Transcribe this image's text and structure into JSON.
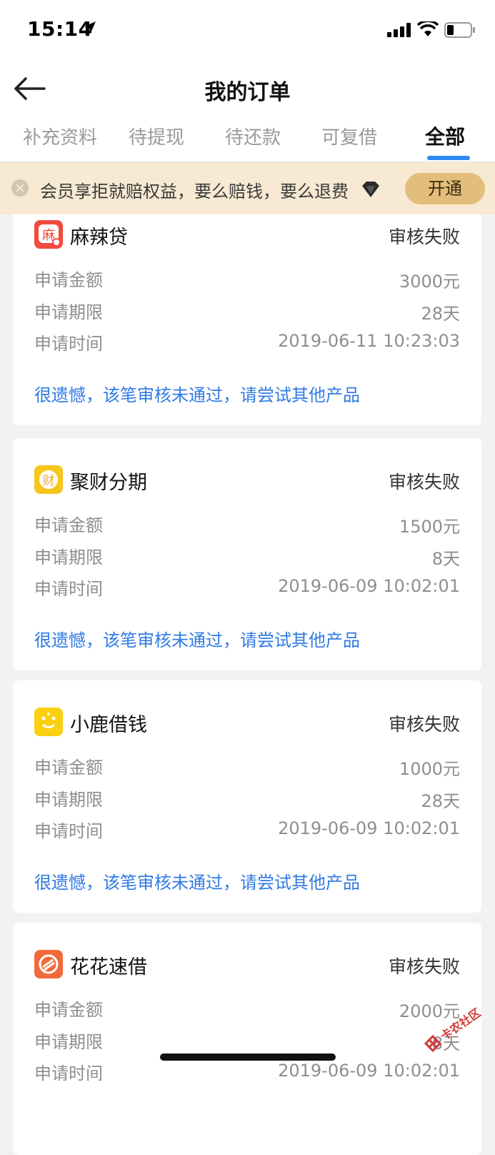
{
  "status_bar": {
    "time": "15:14"
  },
  "header": {
    "title": "我的订单"
  },
  "tabs": [
    {
      "label": "补充资料"
    },
    {
      "label": "待提现"
    },
    {
      "label": "待还款"
    },
    {
      "label": "可复借"
    },
    {
      "label": "全部",
      "active": true
    }
  ],
  "banner": {
    "text": "会员享拒就赔权益，要么赔钱，要么退费",
    "button": "开通"
  },
  "labels": {
    "amount": "申请金额",
    "term": "申请期限",
    "time": "申请时间"
  },
  "orders": [
    {
      "name": "麻辣贷",
      "logo_char": "麻",
      "logo_color": "#f24b3e",
      "status": "审核失败",
      "amount": "3000元",
      "term": "28天",
      "time": "2019-06-11 10:23:03",
      "message": "很遗憾，该笔审核未通过，请尝试其他产品"
    },
    {
      "name": "聚财分期",
      "logo_char": "财",
      "logo_color": "#f8c51c",
      "status": "审核失败",
      "amount": "1500元",
      "term": "8天",
      "time": "2019-06-09 10:02:01",
      "message": "很遗憾，该笔审核未通过，请尝试其他产品"
    },
    {
      "name": "小鹿借钱",
      "logo_char": "",
      "logo_color": "#fbd010",
      "status": "审核失败",
      "amount": "1000元",
      "term": "28天",
      "time": "2019-06-09 10:02:01",
      "message": "很遗憾，该笔审核未通过，请尝试其他产品"
    },
    {
      "name": "花花速借",
      "logo_char": "",
      "logo_color": "#f26a3a",
      "status": "审核失败",
      "amount": "2000元",
      "term": "8天",
      "time": "2019-06-09 10:02:01",
      "message": ""
    }
  ],
  "watermark": {
    "text": "卡农社区"
  },
  "colors": {
    "accent": "#2c8cf4",
    "link": "#2f7ae5",
    "banner_bg": "#f7e9d2",
    "button": "#e3bd7b"
  }
}
